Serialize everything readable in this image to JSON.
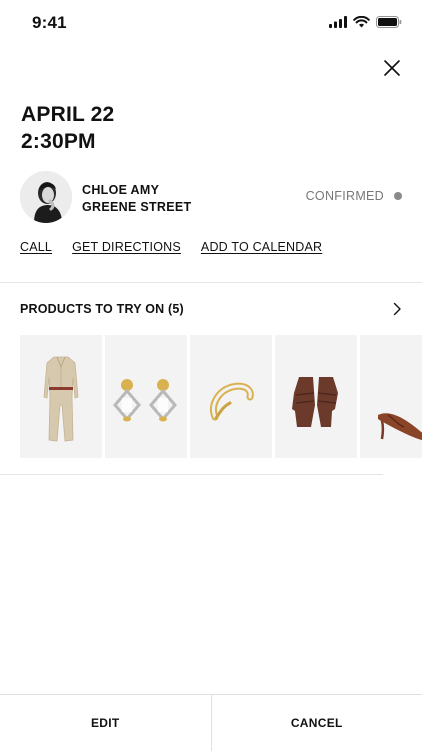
{
  "status_bar": {
    "time": "9:41"
  },
  "appointment": {
    "date": "APRIL 22",
    "time": "2:30PM",
    "client_name": "CHLOE AMY",
    "location": "GREENE STREET",
    "status": "CONFIRMED"
  },
  "actions": {
    "call": "CALL",
    "directions": "GET DIRECTIONS",
    "calendar": "ADD TO CALENDAR"
  },
  "products": {
    "header": "PRODUCTS TO TRY ON (5)",
    "items": [
      {
        "name": "jumpsuit",
        "icon": "jumpsuit-icon"
      },
      {
        "name": "earrings",
        "icon": "earrings-icon"
      },
      {
        "name": "cuff bracelet",
        "icon": "bracelet-icon"
      },
      {
        "name": "gloves",
        "icon": "gloves-icon"
      },
      {
        "name": "slingback heel",
        "icon": "heel-icon"
      }
    ]
  },
  "footer": {
    "edit": "EDIT",
    "cancel": "CANCEL"
  },
  "colors": {
    "status_dot": "#8a8a8a",
    "tile_bg": "#f3f3f3",
    "divider": "#e5e5e5"
  }
}
